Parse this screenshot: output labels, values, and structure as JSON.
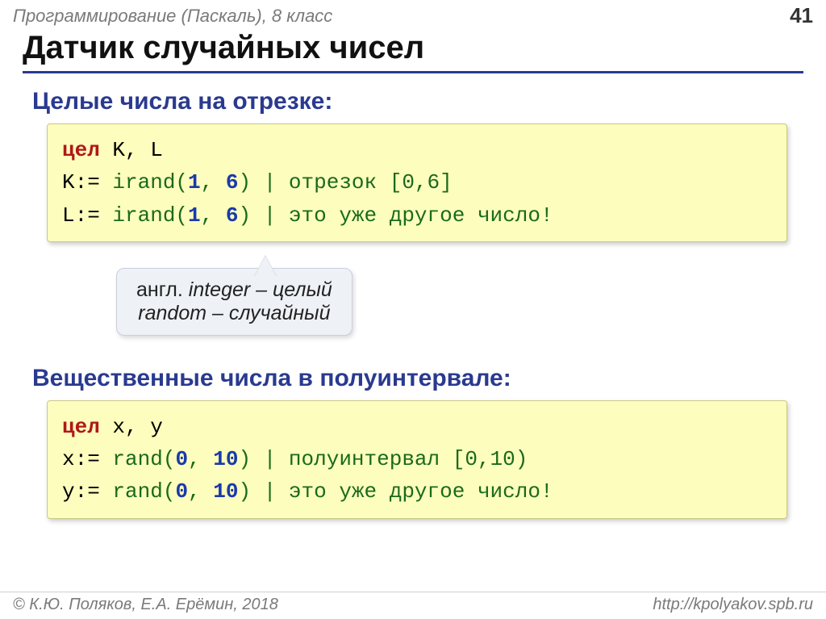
{
  "header": {
    "breadcrumb": "Программирование (Паскаль), 8 класс",
    "page_number": "41"
  },
  "title": "Датчик случайных чисел",
  "section1": {
    "heading": "Целые числа на отрезке:",
    "code": {
      "line1": {
        "kw": "цел",
        "rest": " K, L"
      },
      "line2": {
        "lhs": "K:= ",
        "fn": "irand(",
        "n1": "1",
        "comma": ", ",
        "n2": "6",
        "close": ")",
        "sep": " | ",
        "comment": "отрезок [0,6]"
      },
      "line3": {
        "lhs": "L:= ",
        "fn": "irand(",
        "n1": "1",
        "comma": ", ",
        "n2": "6",
        "close": ")",
        "sep": " | ",
        "comment": "это уже другое число!"
      }
    }
  },
  "note": {
    "line1_pre": "англ. ",
    "line1_it": "integer – целый",
    "line2_it": "random – случайный"
  },
  "section2": {
    "heading": "Вещественные числа в полуинтервале:",
    "code": {
      "line1": {
        "kw": "цел",
        "rest": " x, y"
      },
      "line2": {
        "lhs": "x:= ",
        "fn": "rand(",
        "n1": "0",
        "comma": ", ",
        "n2": "10",
        "close": ")",
        "sep": " | ",
        "comment": "полуинтервал [0,10)"
      },
      "line3": {
        "lhs": "y:= ",
        "fn": "rand(",
        "n1": "0",
        "comma": ", ",
        "n2": "10",
        "close": ")",
        "sep": " | ",
        "comment": "это уже другое число!"
      }
    }
  },
  "footer": {
    "left": "© К.Ю. Поляков, Е.А. Ерёмин, 2018",
    "right": "http://kpolyakov.spb.ru"
  }
}
